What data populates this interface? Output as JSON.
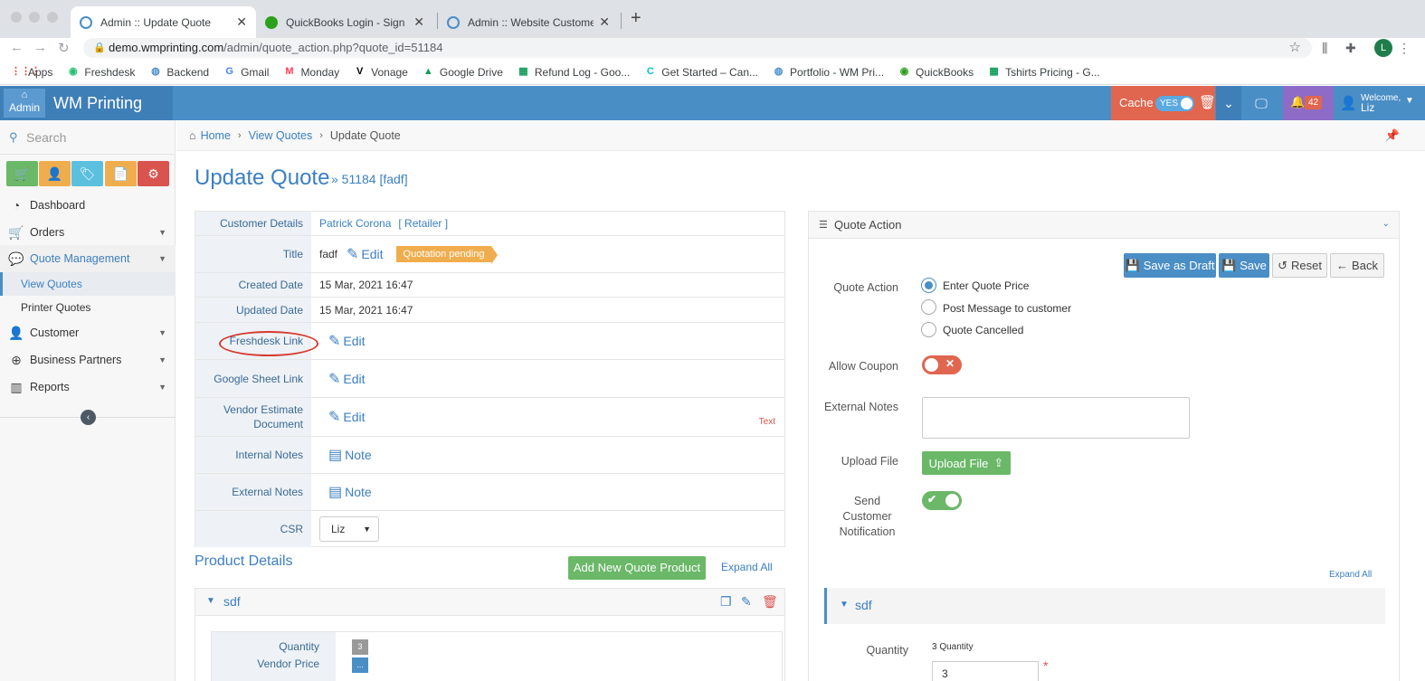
{
  "browser": {
    "tabs": [
      {
        "title": "Admin :: Update Quote",
        "favicon_color": "#4a8ec6"
      },
      {
        "title": "QuickBooks Login - Sign in to Q",
        "favicon_color": "#2ca01c"
      },
      {
        "title": "Admin :: Website Customers",
        "favicon_color": "#4a8ec6"
      }
    ],
    "new_tab": "+",
    "tab_close": "✕",
    "url_host": "demo.wmprinting.com",
    "url_path": "/admin/quote_action.php?quote_id=51184",
    "profile_initial": "L",
    "bookmarks": [
      {
        "label": "Apps",
        "icon": "⋮⋮⋮",
        "color": "#ea4335"
      },
      {
        "label": "Freshdesk",
        "icon": "◉",
        "color": "#25c16f"
      },
      {
        "label": "Backend",
        "icon": "◍",
        "color": "#4a8ec6"
      },
      {
        "label": "Gmail",
        "icon": "G",
        "color": "#4285f4"
      },
      {
        "label": "Monday",
        "icon": "M",
        "color": "#ff3d57"
      },
      {
        "label": "Vonage",
        "icon": "V",
        "color": "#000000"
      },
      {
        "label": "Google Drive",
        "icon": "▲",
        "color": "#0f9d58"
      },
      {
        "label": "Refund Log - Goo...",
        "icon": "▦",
        "color": "#0f9d58"
      },
      {
        "label": "Get Started – Can...",
        "icon": "C",
        "color": "#00c4cc"
      },
      {
        "label": "Portfolio - WM Pri...",
        "icon": "◍",
        "color": "#4a8ec6"
      },
      {
        "label": "QuickBooks",
        "icon": "◉",
        "color": "#2ca01c"
      },
      {
        "label": "Tshirts Pricing - G...",
        "icon": "▦",
        "color": "#0f9d58"
      }
    ]
  },
  "header": {
    "admin_label": "Admin",
    "brand": "WM Printing",
    "cache_label": "Cache",
    "cache_toggle": "YES",
    "notifications": "42",
    "welcome": "Welcome,",
    "user": "Liz"
  },
  "sidebar": {
    "search_placeholder": "Search",
    "quick_buttons": [
      {
        "name": "cart",
        "color": "#6ab868",
        "icon": "🛒"
      },
      {
        "name": "user",
        "color": "#f0ad4e",
        "icon": "👤"
      },
      {
        "name": "tags",
        "color": "#5bc0de",
        "icon": "🏷"
      },
      {
        "name": "document",
        "color": "#f0ad4e",
        "icon": "📄"
      },
      {
        "name": "settings",
        "color": "#d9534f",
        "icon": "⚙"
      }
    ],
    "items": [
      {
        "label": "Dashboard",
        "icon": "◔"
      },
      {
        "label": "Orders",
        "icon": "🛒"
      },
      {
        "label": "Quote Management",
        "icon": "💬"
      },
      {
        "label": "View Quotes"
      },
      {
        "label": "Printer Quotes"
      },
      {
        "label": "Customer",
        "icon": "👤"
      },
      {
        "label": "Business Partners",
        "icon": "⊕"
      },
      {
        "label": "Reports",
        "icon": "▥"
      }
    ]
  },
  "breadcrumb": {
    "home": "Home",
    "view_quotes": "View Quotes",
    "current": "Update Quote"
  },
  "page": {
    "title": "Update Quote",
    "subtitle": "» 51184 [fadf]"
  },
  "details": {
    "customer_label": "Customer Details",
    "customer_name": "Patrick Corona",
    "customer_type": "[ Retailer ]",
    "title_label": "Title",
    "title_value": "fadf",
    "edit": "Edit",
    "status_badge": "Quotation pending",
    "created_label": "Created Date",
    "created_value": "15 Mar, 2021 16:47",
    "updated_label": "Updated Date",
    "updated_value": "15 Mar, 2021 16:47",
    "freshdesk_label": "Freshdesk Link",
    "google_sheet_label": "Google Sheet Link",
    "vendor_estimate_label": "Vendor Estimate Document",
    "vendor_text": "Text",
    "internal_notes_label": "Internal Notes",
    "external_notes_label": "External Notes",
    "note": "Note",
    "csr_label": "CSR",
    "csr_value": "Liz"
  },
  "products": {
    "title": "Product Details",
    "add_button": "Add New Quote Product",
    "expand_all": "Expand All",
    "item_name": "sdf",
    "quantity_label": "Quantity",
    "quantity_value": "3",
    "vendor_price_label": "Vendor Price",
    "vendor_price_value": "..."
  },
  "quote_action": {
    "panel_title": "Quote Action",
    "save_draft": "Save as Draft",
    "save": "Save",
    "reset": "Reset",
    "back": "Back",
    "action_label": "Quote Action",
    "options": [
      "Enter Quote Price",
      "Post Message to customer",
      "Quote Cancelled"
    ],
    "allow_coupon_label": "Allow Coupon",
    "external_notes_label": "External Notes",
    "upload_label": "Upload File",
    "upload_button": "Upload File",
    "notify_label": "Send Customer Notification",
    "expand_all": "Expand All",
    "item_name": "sdf",
    "quantity_label": "Quantity",
    "quantity_caption": "3 Quantity",
    "quantity_value": "3",
    "required_mark": "*"
  }
}
